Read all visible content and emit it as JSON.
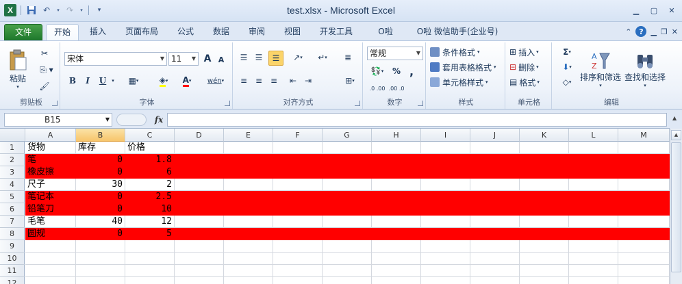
{
  "window": {
    "title": "test.xlsx - Microsoft Excel",
    "logo": "X"
  },
  "tabs": [
    "文件",
    "开始",
    "插入",
    "页面布局",
    "公式",
    "数据",
    "审阅",
    "视图",
    "开发工具",
    "O啦",
    "O啦 微信助手(企业号)"
  ],
  "groups": {
    "clipboard": {
      "label": "剪贴板",
      "paste": "粘贴"
    },
    "font": {
      "label": "字体",
      "name": "宋体",
      "size": "11",
      "bold": "B",
      "italic": "I",
      "underline": "U",
      "grow": "A",
      "shrink": "A",
      "phonetic": "wén"
    },
    "alignment": {
      "label": "对齐方式"
    },
    "number": {
      "label": "数字",
      "format": "常规",
      "percent": "%",
      "comma": ",",
      "inc": ".0 .00",
      "dec": ".00 .0"
    },
    "styles": {
      "label": "样式",
      "conditional": "条件格式",
      "table": "套用表格格式",
      "cell": "单元格样式"
    },
    "cells": {
      "label": "单元格",
      "insert": "插入",
      "delete": "删除",
      "format": "格式"
    },
    "editing": {
      "label": "编辑",
      "sum": "Σ",
      "sort": "排序和筛选",
      "find": "查找和选择"
    }
  },
  "formula_bar": {
    "name_box": "B15",
    "fx": "fx",
    "formula": ""
  },
  "sheet": {
    "columns": [
      "A",
      "B",
      "C",
      "D",
      "E",
      "F",
      "G",
      "H",
      "I",
      "J",
      "K",
      "L",
      "M"
    ],
    "selected_column": "B",
    "rows": [
      {
        "n": "1",
        "a": "货物",
        "b": "库存",
        "c": "价格",
        "red": false,
        "text": true
      },
      {
        "n": "2",
        "a": "笔",
        "b": "0",
        "c": "1.8",
        "red": true
      },
      {
        "n": "3",
        "a": "橡皮擦",
        "b": "0",
        "c": "6",
        "red": true
      },
      {
        "n": "4",
        "a": "尺子",
        "b": "30",
        "c": "2",
        "red": false
      },
      {
        "n": "5",
        "a": "笔记本",
        "b": "0",
        "c": "2.5",
        "red": true
      },
      {
        "n": "6",
        "a": "铅笔刀",
        "b": "0",
        "c": "10",
        "red": true
      },
      {
        "n": "7",
        "a": "毛笔",
        "b": "40",
        "c": "12",
        "red": false
      },
      {
        "n": "8",
        "a": "圆规",
        "b": "0",
        "c": "5",
        "red": true
      },
      {
        "n": "9",
        "a": "",
        "b": "",
        "c": "",
        "red": false
      },
      {
        "n": "10",
        "a": "",
        "b": "",
        "c": "",
        "red": false
      },
      {
        "n": "11",
        "a": "",
        "b": "",
        "c": "",
        "red": false
      },
      {
        "n": "12",
        "a": "",
        "b": "",
        "c": "",
        "red": false
      }
    ]
  },
  "colors": {
    "highlight": "#ff0000",
    "file_tab": "#2e8b3a",
    "selected_header": "#f7c56b"
  }
}
